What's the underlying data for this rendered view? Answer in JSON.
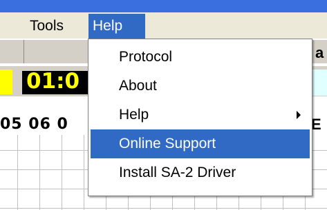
{
  "menubar": {
    "items": [
      {
        "label": "Tools"
      },
      {
        "label": "Help"
      }
    ]
  },
  "background": {
    "timer_text": "01:0",
    "hours_text": "05 06 0",
    "hours_right_text": "E",
    "partial_label_text": "a"
  },
  "help_menu": {
    "items": [
      {
        "label": "Protocol"
      },
      {
        "label": "About"
      },
      {
        "label": "Help",
        "has_submenu": true
      },
      {
        "label": "Online Support",
        "selected": true
      },
      {
        "label": "Install SA-2 Driver"
      }
    ]
  },
  "colors": {
    "menu_highlight": "#316ac5",
    "menubar_bg": "#ece9d8",
    "timer_bg": "#000000",
    "timer_fg": "#ffff00",
    "title_blue": "#3a6fe0"
  },
  "icons": {
    "submenu_arrow": "chevron-right-icon"
  }
}
